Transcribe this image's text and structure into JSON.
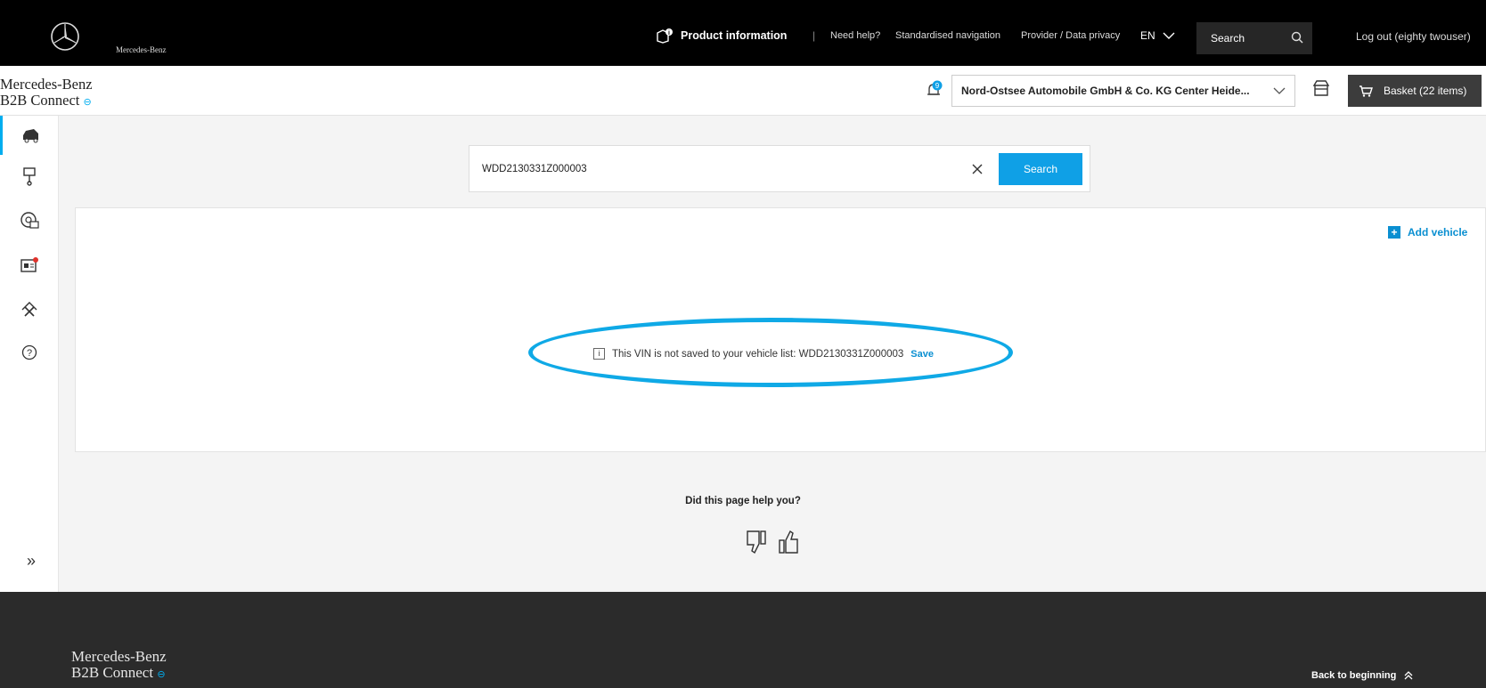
{
  "topbar": {
    "brand_small": "Mercedes-Benz",
    "product_info": "Product information",
    "separator": "|",
    "need_help": "Need help?",
    "standardised_nav": "Standardised navigation",
    "provider": "Provider / Data privacy",
    "lang": "EN",
    "search_placeholder": "Search",
    "logout": "Log out (eighty twouser)"
  },
  "subheader": {
    "brand_line1": "Mercedes-Benz",
    "brand_line2": "B2B Connect",
    "notif_count": "9",
    "dealer": "Nord-Ostsee Automobile GmbH & Co. KG Center Heide...",
    "basket": "Basket (22 items)"
  },
  "search": {
    "value": "WDD2130331Z000003",
    "button": "Search"
  },
  "card": {
    "add_vehicle": "Add vehicle",
    "notice_text": "This VIN is not saved to your vehicle list: WDD2130331Z000003",
    "notice_save": "Save"
  },
  "feedback": {
    "question": "Did this page help you?"
  },
  "footer": {
    "brand_line1": "Mercedes-Benz",
    "brand_line2": "B2B Connect",
    "back": "Back to beginning"
  },
  "colors": {
    "accent": "#0fa0e6",
    "highlight_ellipse": "#0fa9e6"
  }
}
